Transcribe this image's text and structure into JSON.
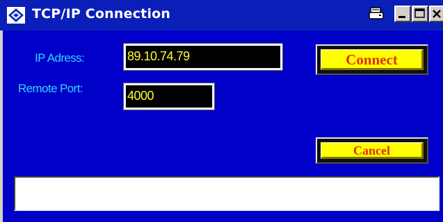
{
  "window": {
    "title": "TCP/IP Connection"
  },
  "form": {
    "ip_label": "IP Adress:",
    "ip_value": "89.10.74.79",
    "port_label": "Remote Port:",
    "port_value": "4000"
  },
  "buttons": {
    "connect": "Connect",
    "cancel": "Cancel"
  },
  "status": {
    "text": ""
  },
  "icons": {
    "app": "rs-diamond-icon",
    "print": "print-icon",
    "minimize": "minimize-icon",
    "maximize": "maximize-icon",
    "close": "close-icon"
  },
  "colors": {
    "titlebar": "#0a1fb8",
    "client": "#0000c8",
    "label": "#2fd4ff",
    "field_text": "#ffff30",
    "button_face": "#ffff00",
    "button_text": "#e03010"
  }
}
